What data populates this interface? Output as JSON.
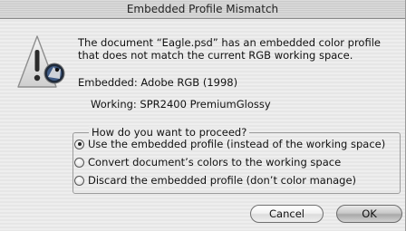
{
  "dialog": {
    "title": "Embedded Profile Mismatch",
    "message": "The document “Eagle.psd” has an embedded color profile that does not match the current RGB working space.",
    "embedded_line": "Embedded: Adobe RGB (1998)",
    "working_line": "Working: SPR2400 PremiumGlossy",
    "question": "How do you want to proceed?",
    "options": [
      {
        "label": "Use the embedded profile (instead of the working space)",
        "selected": true
      },
      {
        "label": "Convert document’s colors to the working space",
        "selected": false
      },
      {
        "label": "Discard the embedded profile (don’t color manage)",
        "selected": false
      }
    ],
    "cancel_label": "Cancel",
    "ok_label": "OK",
    "icon": "alert-triangle-with-photoshop-icon"
  }
}
